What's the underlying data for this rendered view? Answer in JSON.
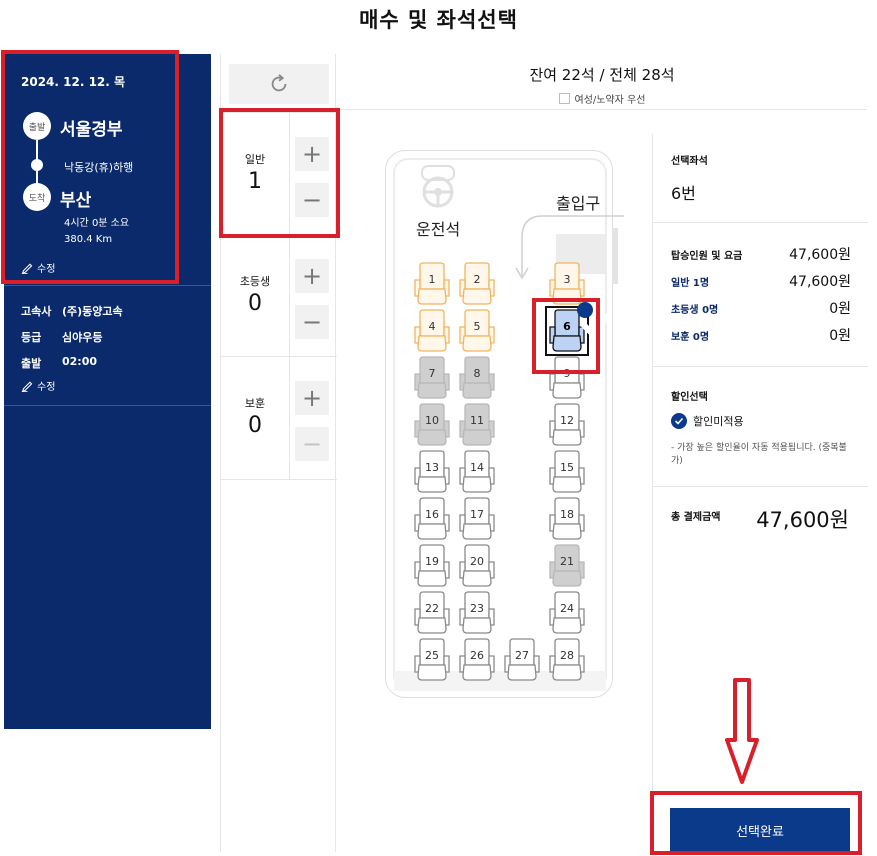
{
  "page_title": "매수 및 좌석선택",
  "trip": {
    "date": "2024. 12. 12. 목",
    "depart_badge": "출발",
    "depart_city": "서울경부",
    "via": "낙동강(휴)하행",
    "arrive_badge": "도착",
    "arrive_city": "부산",
    "duration": "4시간 0분 소요",
    "distance": "380.4 Km",
    "edit_label": "수정"
  },
  "bus_info": {
    "company_key": "고속사",
    "company": "(주)동양고속",
    "grade_key": "등급",
    "grade": "심야우등",
    "depart_key": "출발",
    "depart_time": "02:00",
    "edit_label": "수정"
  },
  "passengers": [
    {
      "label": "일반",
      "count": "1"
    },
    {
      "label": "초등생",
      "count": "0"
    },
    {
      "label": "보훈",
      "count": "0"
    }
  ],
  "seat_header": {
    "remaining": "잔여 22석 / 전체 28석",
    "legend": "여성/노약자 우선"
  },
  "bus_labels": {
    "driver": "운전석",
    "door": "출입구"
  },
  "seats": [
    {
      "num": "1",
      "state": "priority"
    },
    {
      "num": "2",
      "state": "priority"
    },
    {
      "num": "3",
      "state": "priority"
    },
    {
      "num": "4",
      "state": "priority"
    },
    {
      "num": "5",
      "state": "priority"
    },
    {
      "num": "6",
      "state": "selected"
    },
    {
      "num": "7",
      "state": "taken"
    },
    {
      "num": "8",
      "state": "taken"
    },
    {
      "num": "9",
      "state": "available"
    },
    {
      "num": "10",
      "state": "taken"
    },
    {
      "num": "11",
      "state": "taken"
    },
    {
      "num": "12",
      "state": "available"
    },
    {
      "num": "13",
      "state": "available"
    },
    {
      "num": "14",
      "state": "available"
    },
    {
      "num": "15",
      "state": "available"
    },
    {
      "num": "16",
      "state": "available"
    },
    {
      "num": "17",
      "state": "available"
    },
    {
      "num": "18",
      "state": "available"
    },
    {
      "num": "19",
      "state": "available"
    },
    {
      "num": "20",
      "state": "available"
    },
    {
      "num": "21",
      "state": "taken"
    },
    {
      "num": "22",
      "state": "available"
    },
    {
      "num": "23",
      "state": "available"
    },
    {
      "num": "24",
      "state": "available"
    },
    {
      "num": "25",
      "state": "available"
    },
    {
      "num": "26",
      "state": "available"
    },
    {
      "num": "27",
      "state": "available"
    },
    {
      "num": "28",
      "state": "available"
    }
  ],
  "summary": {
    "selected_label": "선택좌석",
    "selected_value": "6번",
    "fare_label": "탑승인원 및 요금",
    "fare_total": "47,600원",
    "general_label": "일반 1명",
    "general_fare": "47,600원",
    "child_label": "초등생 0명",
    "child_fare": "0원",
    "veteran_label": "보훈 0명",
    "veteran_fare": "0원",
    "discount_label": "할인선택",
    "discount_option": "할인미적용",
    "discount_note": "- 가장 높은 할인율이 자동 적용됩니다. (중복불가)",
    "total_label": "총 결제금액",
    "total_value": "47,600원",
    "complete_button": "선택완료"
  },
  "colors": {
    "navy": "#0b2a6b",
    "button_blue": "#0b3a8a",
    "priority_seat": "#f0b560",
    "selected_seat": "#3a74d6",
    "taken_seat": "#cfcfcf",
    "annotation_red": "#d9202a"
  }
}
